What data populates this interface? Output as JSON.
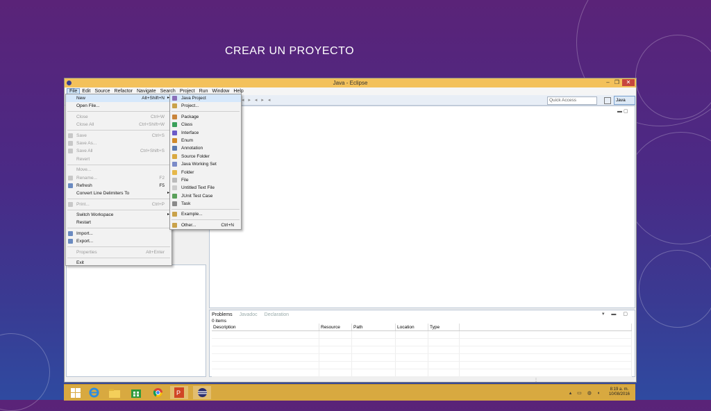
{
  "slide": {
    "title": "CREAR UN PROYECTO"
  },
  "window": {
    "title": "Java - Eclipse",
    "controls": [
      "–",
      "❐",
      "✕"
    ]
  },
  "menubar": [
    "File",
    "Edit",
    "Source",
    "Refactor",
    "Navigate",
    "Search",
    "Project",
    "Run",
    "Window",
    "Help"
  ],
  "toolbar": {
    "quick_access_placeholder": "Quick Access",
    "perspective": "Java"
  },
  "file_menu": [
    {
      "label": "New",
      "shortcut": "Alt+Shift+N",
      "arrow": "▸",
      "state": "highlight"
    },
    {
      "label": "Open File...",
      "shortcut": "",
      "state": "enabled"
    },
    {
      "sep": true
    },
    {
      "label": "Close",
      "shortcut": "Ctrl+W",
      "state": "disabled"
    },
    {
      "label": "Close All",
      "shortcut": "Ctrl+Shift+W",
      "state": "disabled"
    },
    {
      "sep": true
    },
    {
      "label": "Save",
      "shortcut": "Ctrl+S",
      "state": "disabled",
      "icon": "save-icon"
    },
    {
      "label": "Save As...",
      "shortcut": "",
      "state": "disabled",
      "icon": "save-as-icon"
    },
    {
      "label": "Save All",
      "shortcut": "Ctrl+Shift+S",
      "state": "disabled",
      "icon": "save-all-icon"
    },
    {
      "label": "Revert",
      "shortcut": "",
      "state": "disabled"
    },
    {
      "sep": true
    },
    {
      "label": "Move...",
      "shortcut": "",
      "state": "disabled"
    },
    {
      "label": "Rename...",
      "shortcut": "F2",
      "state": "disabled",
      "icon": "rename-icon"
    },
    {
      "label": "Refresh",
      "shortcut": "F5",
      "state": "enabled",
      "icon": "refresh-icon"
    },
    {
      "label": "Convert Line Delimiters To",
      "shortcut": "",
      "arrow": "▸",
      "state": "enabled"
    },
    {
      "sep": true
    },
    {
      "label": "Print...",
      "shortcut": "Ctrl+P",
      "state": "disabled",
      "icon": "print-icon"
    },
    {
      "sep": true
    },
    {
      "label": "Switch Workspace",
      "shortcut": "",
      "arrow": "▸",
      "state": "enabled"
    },
    {
      "label": "Restart",
      "shortcut": "",
      "state": "enabled"
    },
    {
      "sep": true
    },
    {
      "label": "Import...",
      "shortcut": "",
      "state": "enabled",
      "icon": "import-icon"
    },
    {
      "label": "Export...",
      "shortcut": "",
      "state": "enabled",
      "icon": "export-icon"
    },
    {
      "sep": true
    },
    {
      "label": "Properties",
      "shortcut": "Alt+Enter",
      "state": "disabled"
    },
    {
      "sep": true
    },
    {
      "label": "Exit",
      "shortcut": "",
      "state": "enabled"
    }
  ],
  "new_submenu": [
    {
      "label": "Java Project",
      "shortcut": "",
      "icon": "java-project-icon",
      "color": "#8a6fb8",
      "state": "highlight"
    },
    {
      "label": "Project...",
      "shortcut": "",
      "icon": "project-icon",
      "color": "#c9a24a"
    },
    {
      "sep": true
    },
    {
      "label": "Package",
      "shortcut": "",
      "icon": "package-icon",
      "color": "#c9843a"
    },
    {
      "label": "Class",
      "shortcut": "",
      "icon": "class-icon",
      "color": "#3aa05a"
    },
    {
      "label": "Interface",
      "shortcut": "",
      "icon": "interface-icon",
      "color": "#6a5ac8"
    },
    {
      "label": "Enum",
      "shortcut": "",
      "icon": "enum-icon",
      "color": "#d08a2a"
    },
    {
      "label": "Annotation",
      "shortcut": "",
      "icon": "annotation-icon",
      "color": "#5a7ab0"
    },
    {
      "label": "Source Folder",
      "shortcut": "",
      "icon": "source-folder-icon",
      "color": "#d9a940"
    },
    {
      "label": "Java Working Set",
      "shortcut": "",
      "icon": "working-set-icon",
      "color": "#7a8ac8"
    },
    {
      "label": "Folder",
      "shortcut": "",
      "icon": "folder-icon",
      "color": "#e6b84a"
    },
    {
      "label": "File",
      "shortcut": "",
      "icon": "file-icon",
      "color": "#bbbbbb"
    },
    {
      "label": "Untitled Text File",
      "shortcut": "",
      "icon": "text-file-icon",
      "color": "#cccccc"
    },
    {
      "label": "JUnit Test Case",
      "shortcut": "",
      "icon": "junit-icon",
      "color": "#5aa05a"
    },
    {
      "label": "Task",
      "shortcut": "",
      "icon": "task-icon",
      "color": "#8a8a8a"
    },
    {
      "sep": true
    },
    {
      "label": "Example...",
      "shortcut": "",
      "icon": "example-icon",
      "color": "#c9a24a"
    },
    {
      "sep": true
    },
    {
      "label": "Other...",
      "shortcut": "Ctrl+N",
      "icon": "other-icon",
      "color": "#c9a24a"
    }
  ],
  "bottom_panel": {
    "tabs": [
      {
        "label": "Problems",
        "active": true
      },
      {
        "label": "Javadoc",
        "active": false
      },
      {
        "label": "Declaration",
        "active": false
      }
    ],
    "items_count": "0 items",
    "columns": [
      "Description",
      "Resource",
      "Path",
      "Location",
      "Type"
    ]
  },
  "taskbar": {
    "apps": [
      "windows-start-icon",
      "ie-icon",
      "file-explorer-icon",
      "store-icon",
      "chrome-icon",
      "powerpoint-icon",
      "eclipse-icon"
    ],
    "time": "8:19 a. m.",
    "date": "10/08/2016"
  },
  "colors": {
    "highlight": "#d6e8fb",
    "titlebar": "#f3c15b",
    "taskbar": "#d8a940"
  }
}
